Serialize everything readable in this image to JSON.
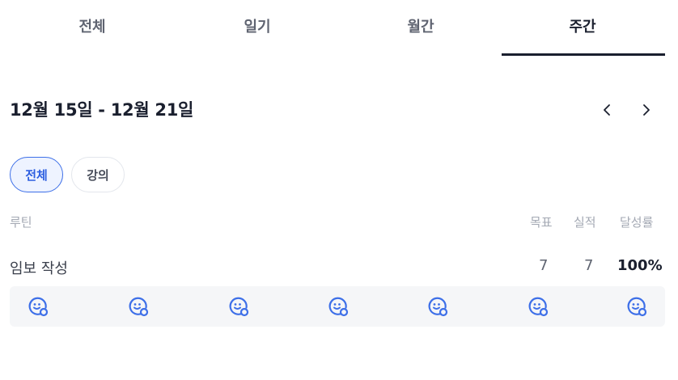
{
  "tabs": [
    {
      "label": "전체",
      "active": false
    },
    {
      "label": "일기",
      "active": false
    },
    {
      "label": "월간",
      "active": false
    },
    {
      "label": "주간",
      "active": true
    }
  ],
  "period": {
    "title": "12월 15일 - 12월 21일",
    "prev_icon": "chevron-left-icon",
    "next_icon": "chevron-right-icon"
  },
  "filters": [
    {
      "label": "전체",
      "active": true
    },
    {
      "label": "강의",
      "active": false
    }
  ],
  "table": {
    "headers": {
      "routine": "루틴",
      "goal": "목표",
      "actual": "실적",
      "rate": "달성률"
    },
    "rows": [
      {
        "name": "임보 작성",
        "goal": "7",
        "actual": "7",
        "rate": "100%",
        "days": [
          "smile-check-icon",
          "smile-check-icon",
          "smile-check-icon",
          "smile-check-icon",
          "smile-check-icon",
          "smile-check-icon",
          "smile-check-icon"
        ]
      }
    ]
  },
  "colors": {
    "accent": "#3d6fe8",
    "text_dark": "#1a1f2e",
    "muted": "#a3a8b3",
    "strip_bg": "#f5f6f8"
  }
}
